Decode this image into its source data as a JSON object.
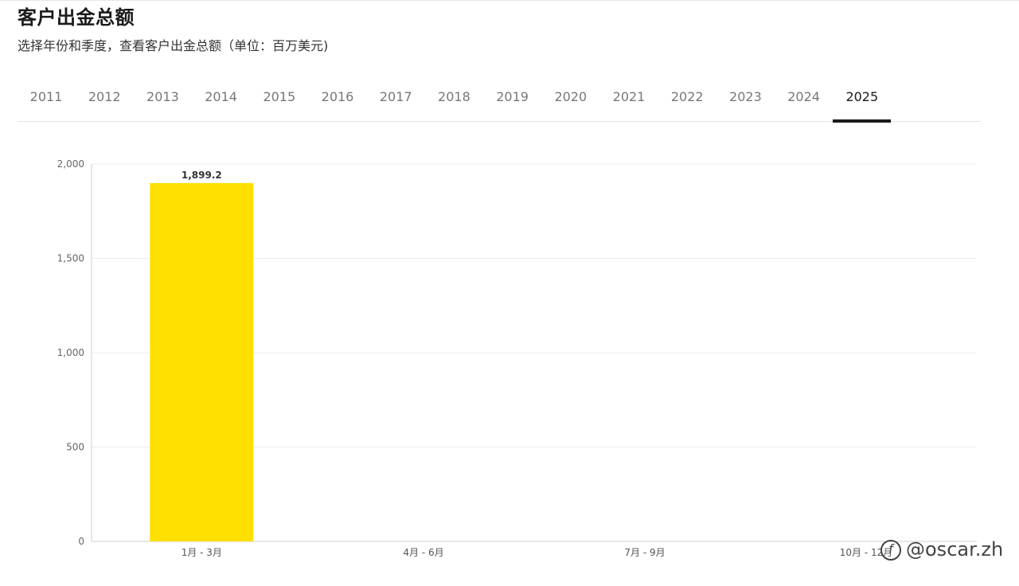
{
  "header": {
    "title": "客户出金总额",
    "subtitle": "选择年份和季度，查看客户出金总额（单位：百万美元)"
  },
  "year_tabs": {
    "items": [
      "2011",
      "2012",
      "2013",
      "2014",
      "2015",
      "2016",
      "2017",
      "2018",
      "2019",
      "2020",
      "2021",
      "2022",
      "2023",
      "2024",
      "2025"
    ],
    "selected": "2025"
  },
  "chart_data": {
    "type": "bar",
    "categories": [
      "1月 - 3月",
      "4月 - 6月",
      "7月 - 9月",
      "10月 - 12月"
    ],
    "values": [
      1899.2,
      null,
      null,
      null
    ],
    "data_labels": [
      "1,899.2",
      "",
      "",
      ""
    ],
    "ylim": [
      0,
      2000
    ],
    "yticks": [
      0,
      500,
      1000,
      1500,
      2000
    ],
    "ytick_labels": [
      "0",
      "500",
      "1,000",
      "1,500",
      "2,000"
    ],
    "bar_color": "#FFE000",
    "grid": true,
    "title": "",
    "xlabel": "",
    "ylabel": ""
  },
  "watermark": {
    "text": "@oscar.zh",
    "icon": "watermark-logo-icon"
  }
}
